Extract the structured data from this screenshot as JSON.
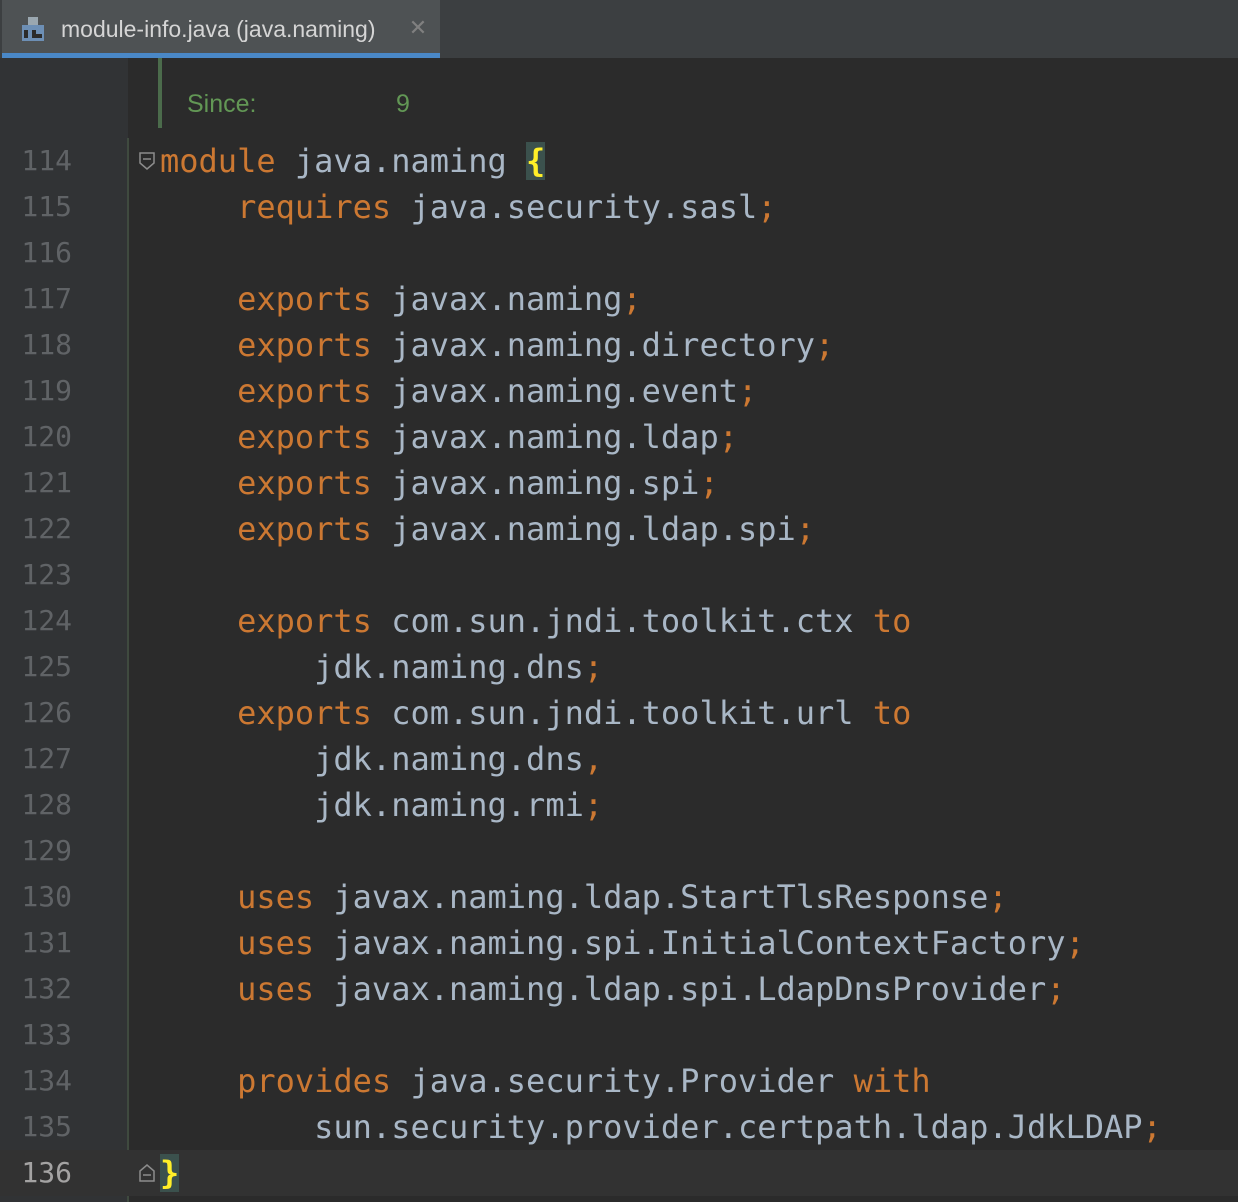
{
  "tab": {
    "title": "module-info.java (java.naming)",
    "icon": "java-module-file-icon",
    "close": "✕"
  },
  "doc": {
    "since_label": "Since:",
    "since_value": "9"
  },
  "colors": {
    "keyword": "#cc7832",
    "identifier": "#a9b7c6",
    "doc": "#629755",
    "brace": "#ffef28",
    "line_number": "#606366"
  },
  "lines": [
    {
      "n": "114",
      "kw": "module",
      "rest": " java.naming ",
      "open": "{"
    },
    {
      "n": "115",
      "kw": "requires",
      "rest": " java.security.sasl",
      "semi": ";"
    },
    {
      "n": "116"
    },
    {
      "n": "117",
      "kw": "exports",
      "rest": " javax.naming",
      "semi": ";"
    },
    {
      "n": "118",
      "kw": "exports",
      "rest": " javax.naming.directory",
      "semi": ";"
    },
    {
      "n": "119",
      "kw": "exports",
      "rest": " javax.naming.event",
      "semi": ";"
    },
    {
      "n": "120",
      "kw": "exports",
      "rest": " javax.naming.ldap",
      "semi": ";"
    },
    {
      "n": "121",
      "kw": "exports",
      "rest": " javax.naming.spi",
      "semi": ";"
    },
    {
      "n": "122",
      "kw": "exports",
      "rest": " javax.naming.ldap.spi",
      "semi": ";"
    },
    {
      "n": "123"
    },
    {
      "n": "124",
      "kw": "exports",
      "rest": " com.sun.jndi.toolkit.ctx ",
      "kw2": "to"
    },
    {
      "n": "125",
      "plain": "jdk.naming.dns",
      "semi": ";"
    },
    {
      "n": "126",
      "kw": "exports",
      "rest": " com.sun.jndi.toolkit.url ",
      "kw2": "to"
    },
    {
      "n": "127",
      "plain": "jdk.naming.dns",
      "semi": ","
    },
    {
      "n": "128",
      "plain": "jdk.naming.rmi",
      "semi": ";"
    },
    {
      "n": "129"
    },
    {
      "n": "130",
      "kw": "uses",
      "rest": " javax.naming.ldap.StartTlsResponse",
      "semi": ";"
    },
    {
      "n": "131",
      "kw": "uses",
      "rest": " javax.naming.spi.InitialContextFactory",
      "semi": ";"
    },
    {
      "n": "132",
      "kw": "uses",
      "rest": " javax.naming.ldap.spi.LdapDnsProvider",
      "semi": ";"
    },
    {
      "n": "133"
    },
    {
      "n": "134",
      "kw": "provides",
      "rest": " java.security.Provider ",
      "kw2": "with"
    },
    {
      "n": "135",
      "plain": "sun.security.provider.certpath.ldap.JdkLDAP",
      "semi": ";"
    },
    {
      "n": "136",
      "close": "}"
    }
  ]
}
